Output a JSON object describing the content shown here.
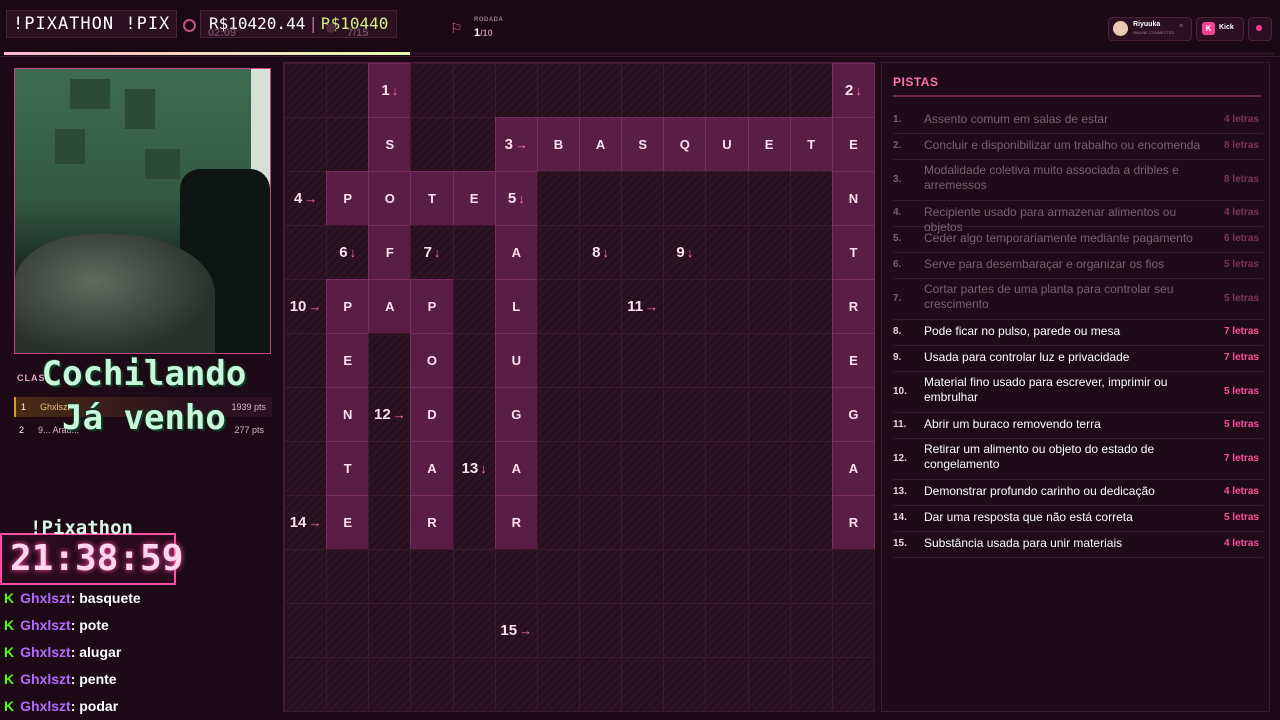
{
  "topbar": {
    "title": "!PIXATHON !PIX",
    "prize_current": "R$10420.44",
    "prize_separator": "|",
    "prize_goal": "R$10440",
    "timer": "02:09",
    "solved": "7/15",
    "round_label": "RODADA",
    "round_current": "1",
    "round_total": "/10",
    "progress_percent": 32,
    "user_name": "Riyuuka",
    "user_sub": "ONLINE CONNECTED",
    "user_close": "×",
    "kick_logo": "K",
    "kick_label": "Kick"
  },
  "overlay": {
    "status": "Cochilando\nJá venho",
    "clock_label": "!Pixathon",
    "clock_time": "21:38:59"
  },
  "leaderboard": {
    "header": "CLAS",
    "rows": [
      {
        "rank": "1",
        "name": "Ghxlszt",
        "points": "1939 pts"
      },
      {
        "rank": "2",
        "name": "9... Arau...",
        "points": "277 pts"
      }
    ]
  },
  "chat": [
    {
      "user": "Ghxlszt",
      "text": ": basquete"
    },
    {
      "user": "Ghxlszt",
      "text": ": pote"
    },
    {
      "user": "Ghxlszt",
      "text": ": alugar"
    },
    {
      "user": "Ghxlszt",
      "text": ": pente"
    },
    {
      "user": "Ghxlszt",
      "text": ": podar"
    }
  ],
  "grid": {
    "cols": 14,
    "rows": 12,
    "cells": [
      {
        "r": 0,
        "c": 2,
        "num": "1",
        "arrow": "↓"
      },
      {
        "r": 0,
        "c": 13,
        "num": "2",
        "arrow": "↓"
      },
      {
        "r": 1,
        "c": 2,
        "letter": "S"
      },
      {
        "r": 1,
        "c": 5,
        "num": "3",
        "arrow": "→"
      },
      {
        "r": 1,
        "c": 6,
        "letter": "B"
      },
      {
        "r": 1,
        "c": 7,
        "letter": "A"
      },
      {
        "r": 1,
        "c": 8,
        "letter": "S"
      },
      {
        "r": 1,
        "c": 9,
        "letter": "Q"
      },
      {
        "r": 1,
        "c": 10,
        "letter": "U"
      },
      {
        "r": 1,
        "c": 11,
        "letter": "E"
      },
      {
        "r": 1,
        "c": 12,
        "letter": "T"
      },
      {
        "r": 1,
        "c": 13,
        "letter": "E"
      },
      {
        "r": 2,
        "c": 0,
        "num": "4",
        "arrow": "→"
      },
      {
        "r": 2,
        "c": 1,
        "letter": "P"
      },
      {
        "r": 2,
        "c": 2,
        "letter": "O"
      },
      {
        "r": 2,
        "c": 3,
        "letter": "T"
      },
      {
        "r": 2,
        "c": 4,
        "letter": "E"
      },
      {
        "r": 2,
        "c": 5,
        "num": "5",
        "arrow": "↓"
      },
      {
        "r": 2,
        "c": 13,
        "letter": "N"
      },
      {
        "r": 3,
        "c": 1,
        "num": "6",
        "arrow": "↓"
      },
      {
        "r": 3,
        "c": 2,
        "letter": "F"
      },
      {
        "r": 3,
        "c": 3,
        "num": "7",
        "arrow": "↓"
      },
      {
        "r": 3,
        "c": 5,
        "letter": "A"
      },
      {
        "r": 3,
        "c": 7,
        "num": "8",
        "arrow": "↓"
      },
      {
        "r": 3,
        "c": 9,
        "num": "9",
        "arrow": "↓"
      },
      {
        "r": 3,
        "c": 13,
        "letter": "T"
      },
      {
        "r": 4,
        "c": 0,
        "num": "10",
        "arrow": "→"
      },
      {
        "r": 4,
        "c": 1,
        "letter": "P"
      },
      {
        "r": 4,
        "c": 2,
        "letter": "A"
      },
      {
        "r": 4,
        "c": 3,
        "letter": "P"
      },
      {
        "r": 4,
        "c": 5,
        "letter": "L"
      },
      {
        "r": 4,
        "c": 8,
        "num": "11",
        "arrow": "→"
      },
      {
        "r": 4,
        "c": 13,
        "letter": "R"
      },
      {
        "r": 5,
        "c": 1,
        "letter": "E"
      },
      {
        "r": 5,
        "c": 3,
        "letter": "O"
      },
      {
        "r": 5,
        "c": 5,
        "letter": "U"
      },
      {
        "r": 5,
        "c": 13,
        "letter": "E"
      },
      {
        "r": 6,
        "c": 1,
        "letter": "N"
      },
      {
        "r": 6,
        "c": 2,
        "num": "12",
        "arrow": "→"
      },
      {
        "r": 6,
        "c": 3,
        "letter": "D"
      },
      {
        "r": 6,
        "c": 5,
        "letter": "G"
      },
      {
        "r": 6,
        "c": 13,
        "letter": "G"
      },
      {
        "r": 7,
        "c": 1,
        "letter": "T"
      },
      {
        "r": 7,
        "c": 3,
        "letter": "A"
      },
      {
        "r": 7,
        "c": 4,
        "num": "13",
        "arrow": "↓"
      },
      {
        "r": 7,
        "c": 5,
        "letter": "A"
      },
      {
        "r": 7,
        "c": 13,
        "letter": "A"
      },
      {
        "r": 8,
        "c": 0,
        "num": "14",
        "arrow": "→"
      },
      {
        "r": 8,
        "c": 1,
        "letter": "E"
      },
      {
        "r": 8,
        "c": 3,
        "letter": "R"
      },
      {
        "r": 8,
        "c": 5,
        "letter": "R"
      },
      {
        "r": 8,
        "c": 13,
        "letter": "R"
      },
      {
        "r": 10,
        "c": 5,
        "num": "15",
        "arrow": "→"
      }
    ]
  },
  "clues": {
    "title": "PISTAS",
    "items": [
      {
        "n": "1.",
        "text": "Assento comum em salas de estar",
        "len": "4 letras",
        "done": true
      },
      {
        "n": "2.",
        "text": "Concluir e disponibilizar um trabalho ou encomenda",
        "len": "8 letras",
        "done": true
      },
      {
        "n": "3.",
        "text": "Modalidade coletiva muito associada a dribles e arremessos",
        "len": "8 letras",
        "done": true
      },
      {
        "n": "4.",
        "text": "Recipiente usado para armazenar alimentos ou objetos",
        "len": "4 letras",
        "done": true
      },
      {
        "n": "5.",
        "text": "Ceder algo temporariamente mediante pagamento",
        "len": "6 letras",
        "done": true
      },
      {
        "n": "6.",
        "text": "Serve para desembaraçar e organizar os fios",
        "len": "5 letras",
        "done": true
      },
      {
        "n": "7.",
        "text": "Cortar partes de uma planta para controlar seu crescimento",
        "len": "5 letras",
        "done": true
      },
      {
        "n": "8.",
        "text": "Pode ficar no pulso, parede ou mesa",
        "len": "7 letras",
        "done": false
      },
      {
        "n": "9.",
        "text": "Usada para controlar luz e privacidade",
        "len": "7 letras",
        "done": false
      },
      {
        "n": "10.",
        "text": "Material fino usado para escrever, imprimir ou embrulhar",
        "len": "5 letras",
        "done": false
      },
      {
        "n": "11.",
        "text": "Abrir um buraco removendo terra",
        "len": "5 letras",
        "done": false
      },
      {
        "n": "12.",
        "text": "Retirar um alimento ou objeto do estado de congelamento",
        "len": "7 letras",
        "done": false
      },
      {
        "n": "13.",
        "text": "Demonstrar profundo carinho ou dedicação",
        "len": "4 letras",
        "done": false
      },
      {
        "n": "14.",
        "text": "Dar uma resposta que não está correta",
        "len": "5 letras",
        "done": false
      },
      {
        "n": "15.",
        "text": "Substância usada para unir materiais",
        "len": "4 letras",
        "done": false
      }
    ]
  },
  "colors": {
    "accent": "#ff4fa3",
    "filled_cell": "#5a1d45",
    "kick_green": "#53fc18"
  }
}
